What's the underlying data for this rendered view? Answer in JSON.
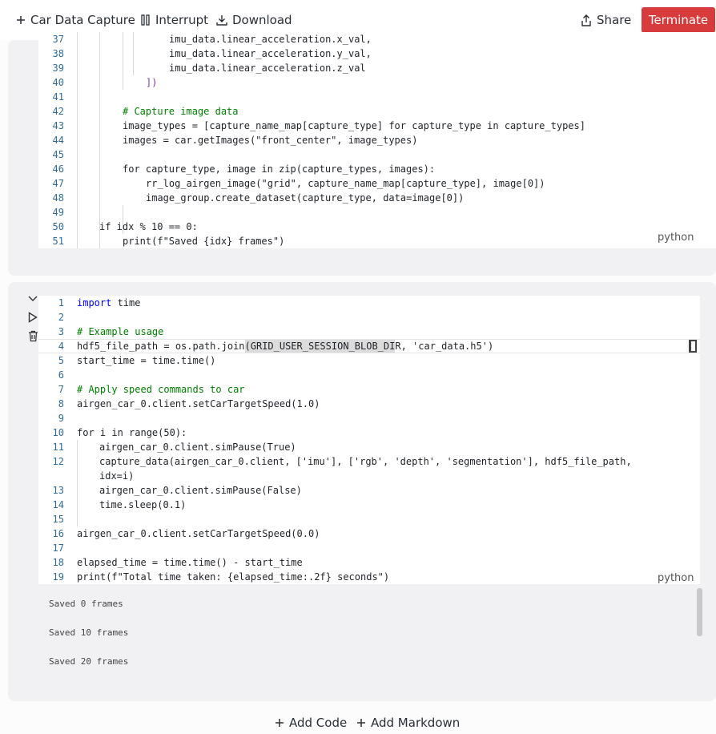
{
  "toolbar": {
    "title": "Car Data Capture",
    "interrupt": "Interrupt",
    "download": "Download",
    "share": "Share",
    "terminate": "Terminate"
  },
  "cell1": {
    "language": "python",
    "lines": [
      {
        "n": "37",
        "t": "imu_data.linear_acceleration.x_val,"
      },
      {
        "n": "38",
        "t": "imu_data.linear_acceleration.y_val,"
      },
      {
        "n": "39",
        "t": "imu_data.linear_acceleration.z_val"
      },
      {
        "n": "40",
        "t": "])"
      },
      {
        "n": "41",
        "t": ""
      },
      {
        "n": "42",
        "t": "# Capture image data"
      },
      {
        "n": "43",
        "t": "image_types = [capture_name_map[capture_type] for capture_type in capture_types]"
      },
      {
        "n": "44",
        "t": "images = car.getImages(\"front_center\", image_types)"
      },
      {
        "n": "45",
        "t": ""
      },
      {
        "n": "46",
        "t": "for capture_type, image in zip(capture_types, images):"
      },
      {
        "n": "47",
        "t": "rr_log_airgen_image(\"grid\", capture_name_map[capture_type], image[0])"
      },
      {
        "n": "48",
        "t": "image_group.create_dataset(capture_type, data=image[0])"
      },
      {
        "n": "49",
        "t": ""
      },
      {
        "n": "50",
        "t": "if idx % 10 == 0:"
      },
      {
        "n": "51",
        "t": "print(f\"Saved {idx} frames\")"
      }
    ]
  },
  "cell2": {
    "language": "python",
    "lines": [
      {
        "n": "1",
        "t": "import time"
      },
      {
        "n": "2",
        "t": ""
      },
      {
        "n": "3",
        "t": "# Example usage"
      },
      {
        "n": "4",
        "t": "hdf5_file_path = os.path.join(GRID_USER_SESSION_BLOB_DIR, 'car_data.h5')"
      },
      {
        "n": "5",
        "t": "start_time = time.time()"
      },
      {
        "n": "6",
        "t": ""
      },
      {
        "n": "7",
        "t": "# Apply speed commands to car"
      },
      {
        "n": "8",
        "t": "airgen_car_0.client.setCarTargetSpeed(1.0)"
      },
      {
        "n": "9",
        "t": ""
      },
      {
        "n": "10",
        "t": "for i in range(50):"
      },
      {
        "n": "11",
        "t": "airgen_car_0.client.simPause(True)"
      },
      {
        "n": "12",
        "t": "capture_data(airgen_car_0.client, ['imu'], ['rgb', 'depth', 'segmentation'], hdf5_file_path,"
      },
      {
        "n": "",
        "t": "idx=i)"
      },
      {
        "n": "13",
        "t": "airgen_car_0.client.simPause(False)"
      },
      {
        "n": "14",
        "t": "time.sleep(0.1)"
      },
      {
        "n": "15",
        "t": ""
      },
      {
        "n": "16",
        "t": "airgen_car_0.client.setCarTargetSpeed(0.0)"
      },
      {
        "n": "17",
        "t": ""
      },
      {
        "n": "18",
        "t": "elapsed_time = time.time() - start_time"
      },
      {
        "n": "19",
        "t": "print(f\"Total time taken: {elapsed_time:.2f} seconds\")"
      }
    ],
    "output": [
      "Saved 0 frames",
      "Saved 10 frames",
      "Saved 20 frames"
    ]
  },
  "footer": {
    "add_code": "Add Code",
    "add_markdown": "Add Markdown"
  }
}
